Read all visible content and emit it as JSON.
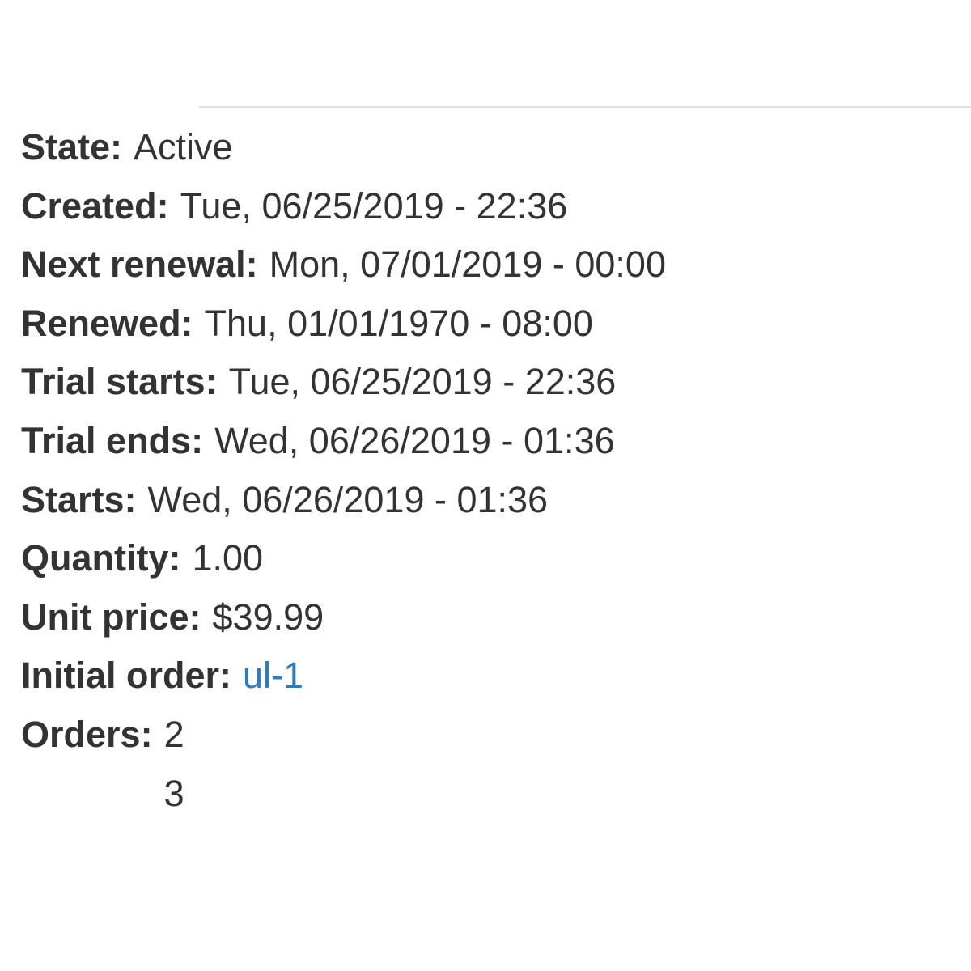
{
  "subscription": {
    "fields": [
      {
        "label": "State:",
        "value": "Active"
      },
      {
        "label": "Created:",
        "value": "Tue, 06/25/2019 - 22:36"
      },
      {
        "label": "Next renewal:",
        "value": "Mon, 07/01/2019 - 00:00"
      },
      {
        "label": "Renewed:",
        "value": "Thu, 01/01/1970 - 08:00"
      },
      {
        "label": "Trial starts:",
        "value": "Tue, 06/25/2019 - 22:36"
      },
      {
        "label": "Trial ends:",
        "value": "Wed, 06/26/2019 - 01:36"
      },
      {
        "label": "Starts:",
        "value": "Wed, 06/26/2019 - 01:36"
      },
      {
        "label": "Quantity:",
        "value": "1.00"
      },
      {
        "label": "Unit price:",
        "value": "$39.99"
      },
      {
        "label": "Initial order:",
        "value": "ul-1"
      }
    ],
    "orders": {
      "label": "Orders:",
      "values": [
        "2",
        "3"
      ]
    }
  },
  "colors": {
    "text": "#333333",
    "link": "#2f7bbf",
    "divider": "#e2e2e2"
  }
}
